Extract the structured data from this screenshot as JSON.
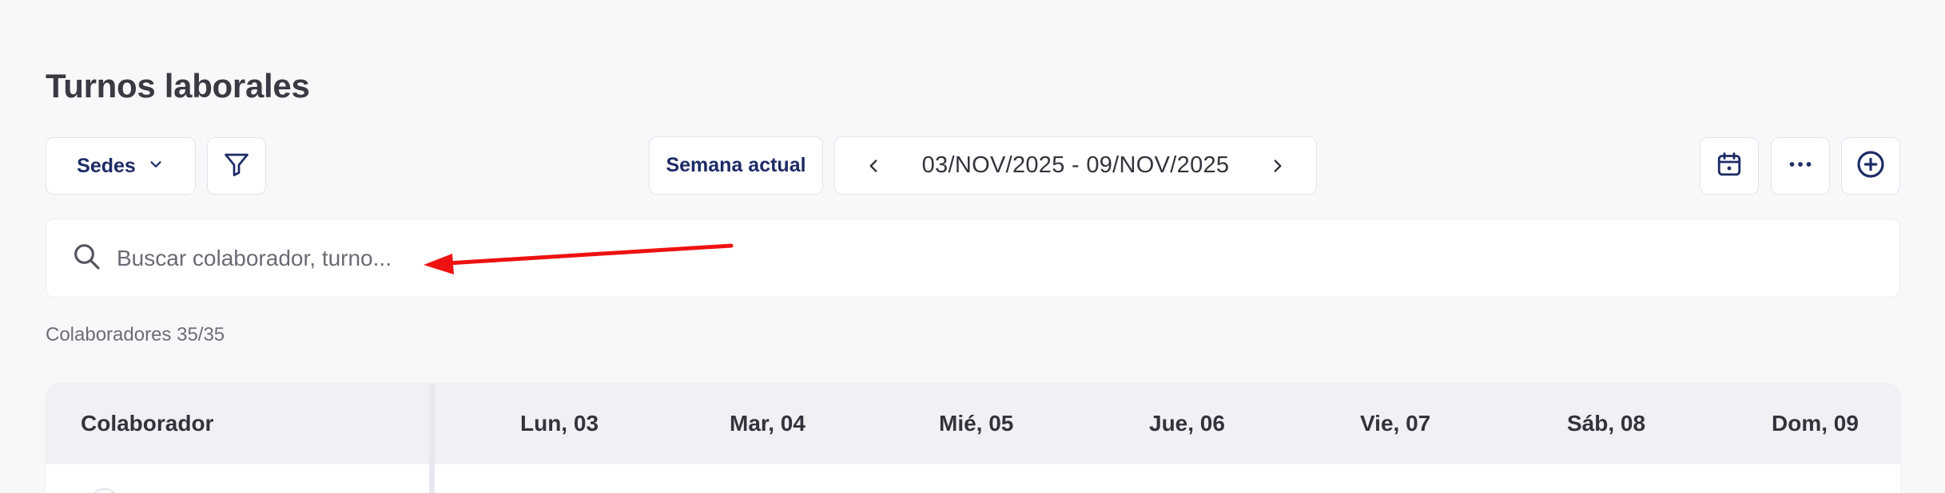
{
  "page": {
    "title": "Turnos laborales"
  },
  "toolbar": {
    "sedes_label": "Sedes",
    "semana_label": "Semana actual",
    "date_range": "03/NOV/2025 - 09/NOV/2025"
  },
  "search": {
    "placeholder": "Buscar colaborador, turno...",
    "value": ""
  },
  "count_text": "Colaboradores 35/35",
  "table": {
    "first_column": "Colaborador",
    "days": [
      "Lun, 03",
      "Mar, 04",
      "Mié, 05",
      "Jue, 06",
      "Vie, 07",
      "Sáb, 08",
      "Dom, 09"
    ]
  },
  "colors": {
    "accent": "#1d2b66",
    "background": "#f8f8fb",
    "annotation": "#ee1111"
  },
  "icons": [
    "chevron-down-icon",
    "filter-icon",
    "chevron-left-icon",
    "chevron-right-icon",
    "calendar-icon",
    "more-horizontal-icon",
    "add-circle-icon",
    "search-icon"
  ]
}
